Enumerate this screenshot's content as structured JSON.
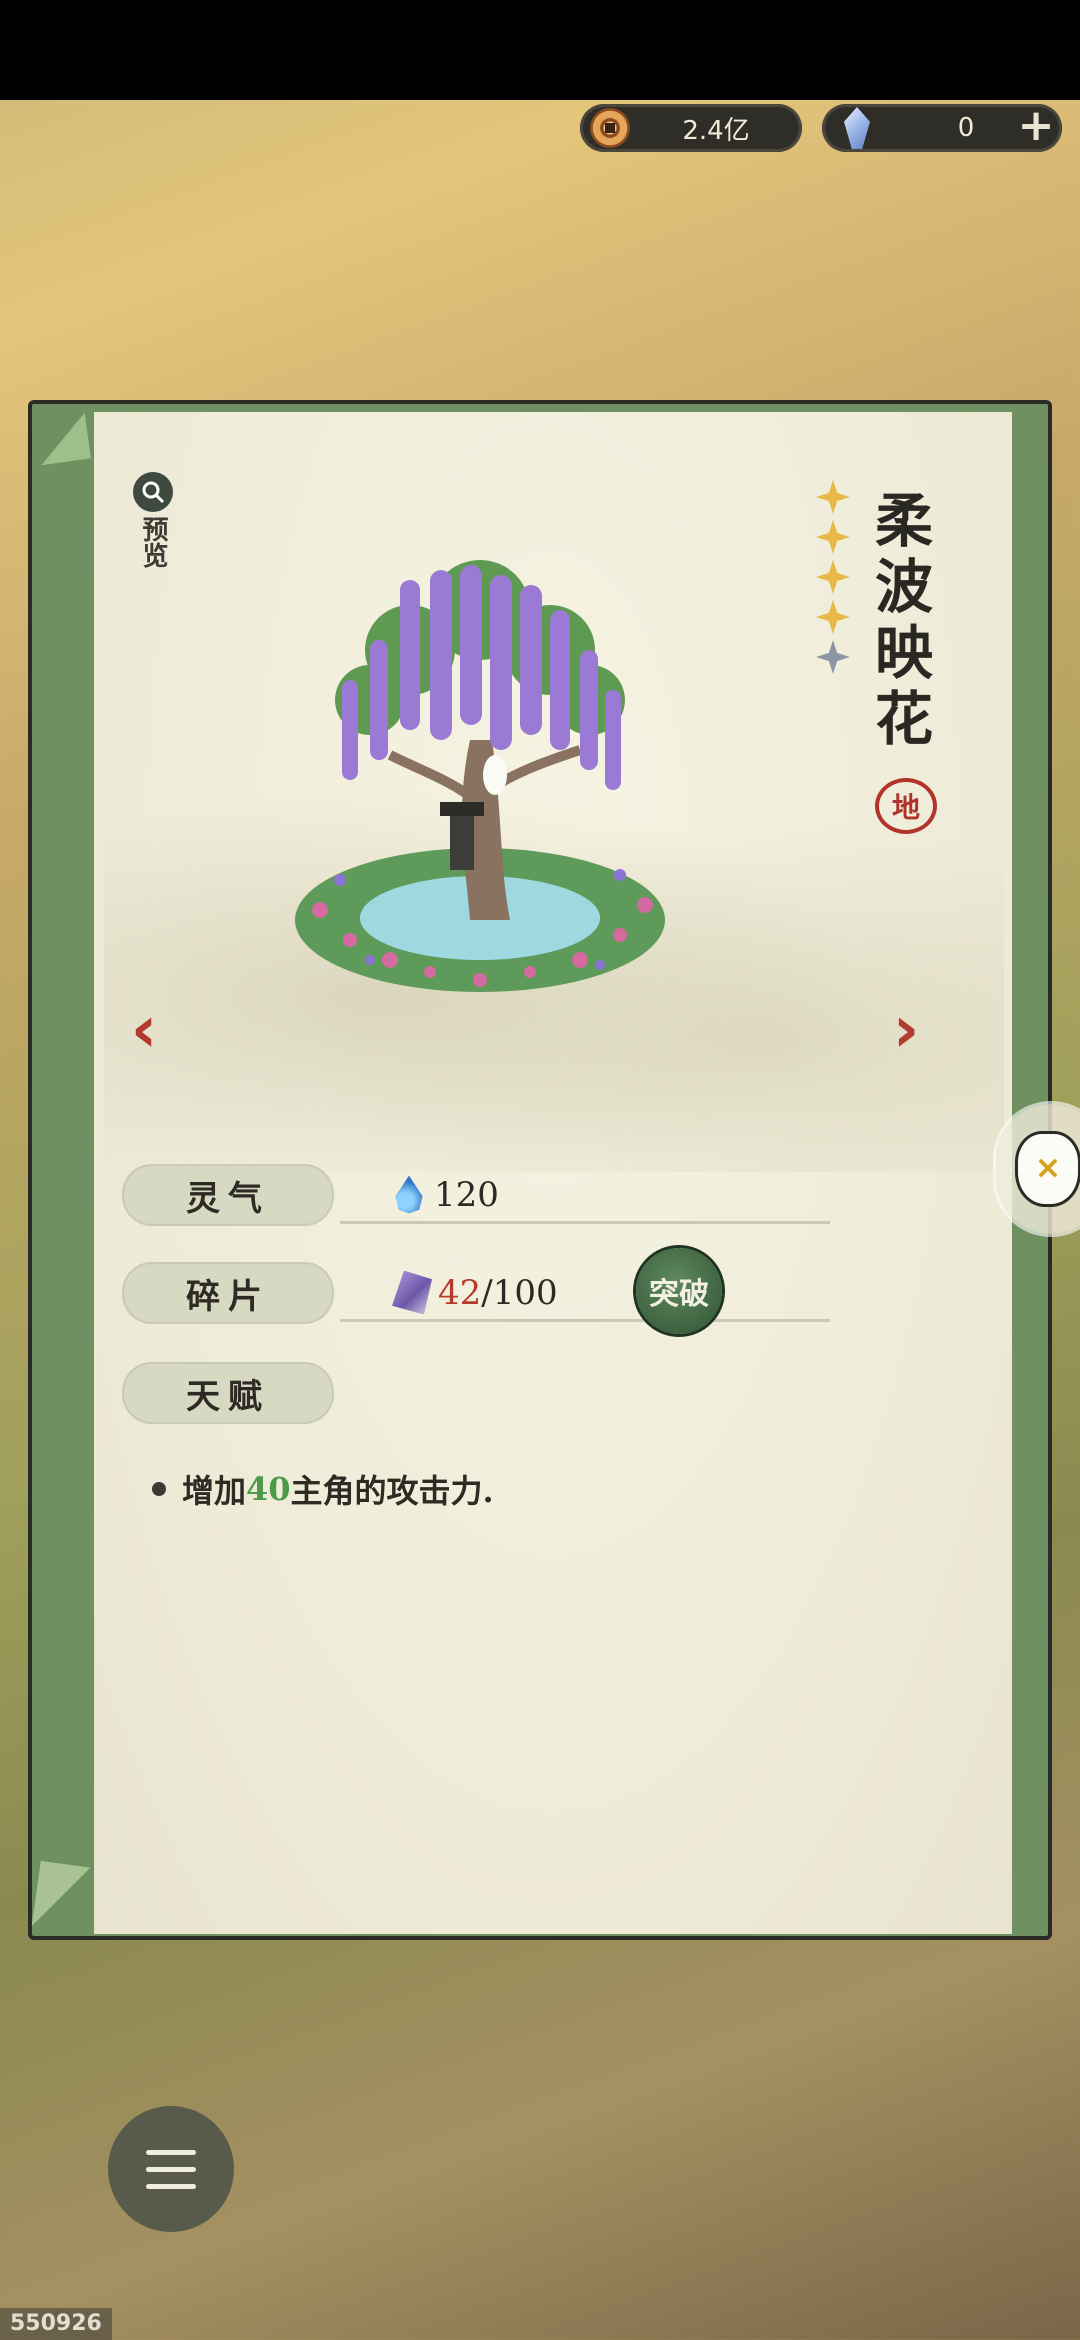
{
  "currency": {
    "coins": "2.4亿",
    "gems": "0"
  },
  "preview": {
    "label": "预览"
  },
  "item": {
    "name": "柔波映花",
    "rank": "地",
    "stars_filled": 4,
    "stars_total": 5
  },
  "stats": {
    "spirit": {
      "label": "灵气",
      "value": "120"
    },
    "fragments": {
      "label": "碎片",
      "current": "42",
      "total": "/100",
      "button": "突破"
    },
    "talent": {
      "label": "天赋",
      "desc_prefix": "增加",
      "desc_value": "40",
      "desc_suffix": "主角的攻击力."
    }
  },
  "build_id": "550926"
}
